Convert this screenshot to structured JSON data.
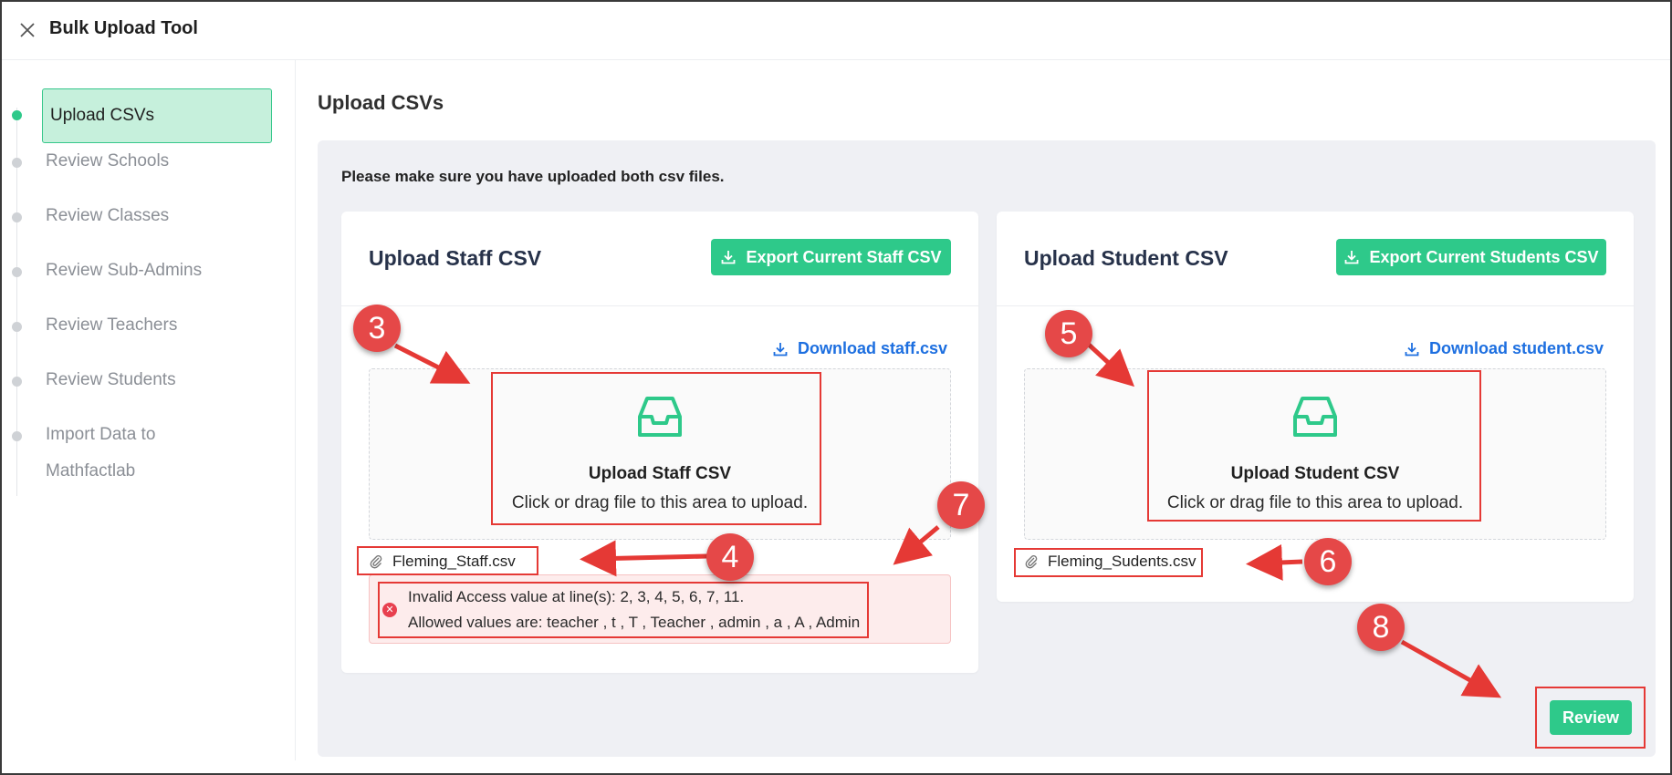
{
  "header": {
    "title": "Bulk Upload Tool"
  },
  "sidebar": {
    "steps": [
      {
        "label": "Upload CSVs"
      },
      {
        "label": "Review Schools"
      },
      {
        "label": "Review Classes"
      },
      {
        "label": "Review Sub-Admins"
      },
      {
        "label": "Review Teachers"
      },
      {
        "label": "Review Students"
      },
      {
        "label_line1": "Import Data to",
        "label_line2": "Mathfactlab"
      }
    ]
  },
  "main": {
    "heading": "Upload CSVs",
    "notice": "Please make sure you have uploaded both csv files.",
    "staff": {
      "title": "Upload Staff CSV",
      "export_label": "Export Current Staff CSV",
      "download_label": "Download staff.csv",
      "dropzone_title": "Upload Staff CSV",
      "dropzone_hint": "Click or drag file to this area to upload.",
      "file_name": "Fleming_Staff.csv",
      "error_line1": "Invalid Access value at line(s): 2, 3, 4, 5, 6, 7, 11.",
      "error_line2": "Allowed values are: teacher , t , T , Teacher , admin , a , A , Admin"
    },
    "student": {
      "title": "Upload Student CSV",
      "export_label": "Export Current Students CSV",
      "download_label": "Download student.csv",
      "dropzone_title": "Upload Student CSV",
      "dropzone_hint": "Click or drag file to this area to upload.",
      "file_name": "Fleming_Sudents.csv"
    },
    "review_label": "Review"
  },
  "annotations": [
    "3",
    "4",
    "5",
    "6",
    "7",
    "8"
  ],
  "colors": {
    "accent": "#2ec98a",
    "link": "#1d6fe0",
    "annotation": "#e53935"
  }
}
